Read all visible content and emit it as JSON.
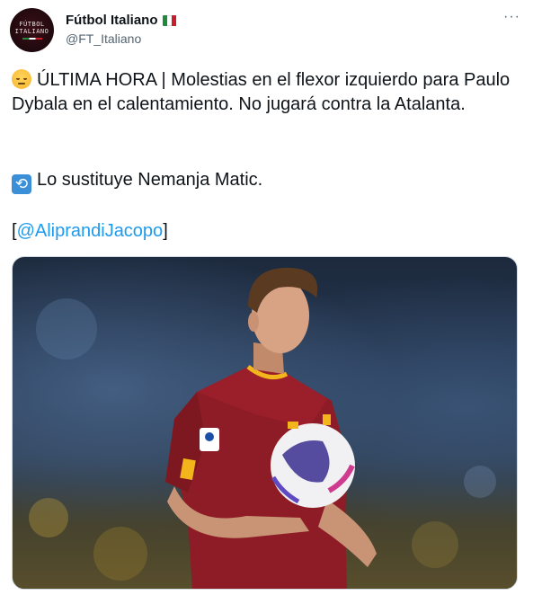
{
  "account": {
    "name": "Fútbol Italiano",
    "handle": "@FT_Italiano",
    "avatar_text_line1": "FÚTBOL",
    "avatar_text_line2": "ITALIANO",
    "flag_colors": [
      "#1f8a3b",
      "#ffffff",
      "#c81e2b"
    ]
  },
  "menu": {
    "more_label": "···"
  },
  "tweet": {
    "line1": "ÚLTIMA HORA | Molestias en el flexor izquierdo para Paulo Dybala en el calentamiento. No jugará contra la Atalanta.",
    "line2": "Lo sustituye Nemanja Matic.",
    "credit_open": "[",
    "credit_mention": "@AliprandiJacopo",
    "credit_close": "]"
  },
  "icons": {
    "face": "relieved-face-icon",
    "cycle": "counterclockwise-arrows-icon",
    "flag": "italy-flag-icon",
    "more": "more-options-icon"
  },
  "colors": {
    "link": "#1d9bf0",
    "secondary_text": "#536471",
    "kit_red": "#8e1c26",
    "kit_yellow": "#f2b51b"
  },
  "media": {
    "description_visible": false
  }
}
